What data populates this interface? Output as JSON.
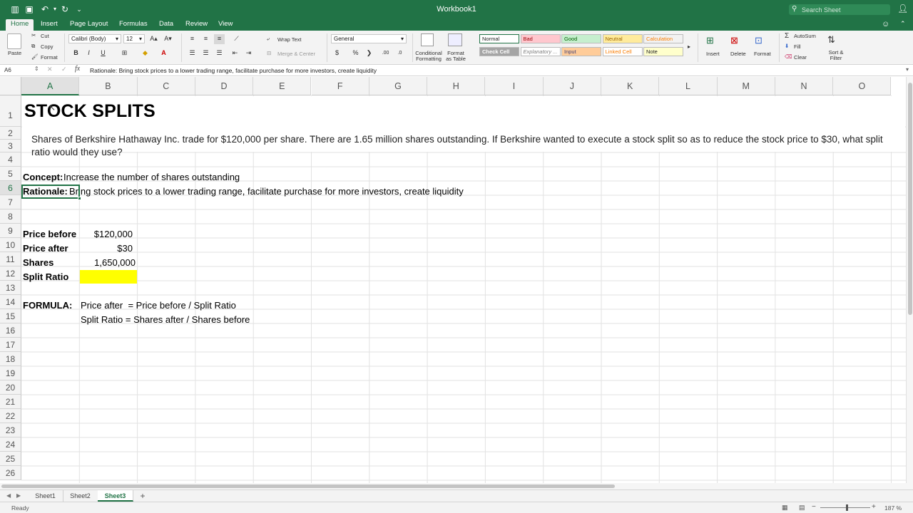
{
  "window": {
    "title": "Workbook1"
  },
  "search": {
    "placeholder": "Search Sheet"
  },
  "tabs": [
    "Home",
    "Insert",
    "Page Layout",
    "Formulas",
    "Data",
    "Review",
    "View"
  ],
  "ribbon": {
    "clipboard": {
      "paste": "Paste",
      "cut": "Cut",
      "copy": "Copy",
      "format": "Format"
    },
    "font": {
      "name": "Calibri (Body)",
      "size": "12",
      "bold": "B",
      "italic": "I",
      "underline": "U"
    },
    "alignment": {
      "wrap_text": "Wrap Text",
      "merge_center": "Merge & Center"
    },
    "number": {
      "format": "General",
      "currency": "$",
      "percent": "%",
      "comma": "❯"
    },
    "styles": {
      "conditional_formatting": [
        "Conditional",
        "Formatting"
      ],
      "format_as_table": [
        "Format",
        "as Table"
      ],
      "cells": [
        {
          "label": "Normal",
          "bg": "#ffffff",
          "fg": "#222222"
        },
        {
          "label": "Bad",
          "bg": "#ffc7ce",
          "fg": "#9c0006"
        },
        {
          "label": "Good",
          "bg": "#c6efce",
          "fg": "#006100"
        },
        {
          "label": "Neutral",
          "bg": "#ffeb9c",
          "fg": "#9c6500"
        },
        {
          "label": "Calculation",
          "bg": "#f2f2f2",
          "fg": "#fa7d00"
        },
        {
          "label": "Check Cell",
          "bg": "#a5a5a5",
          "fg": "#ffffff"
        },
        {
          "label": "Explanatory ...",
          "bg": "#ffffff",
          "fg": "#7f7f7f"
        },
        {
          "label": "Input",
          "bg": "#ffcc99",
          "fg": "#3f3f76"
        },
        {
          "label": "Linked Cell",
          "bg": "#ffffff",
          "fg": "#fa7d00"
        },
        {
          "label": "Note",
          "bg": "#ffffcc",
          "fg": "#222222"
        }
      ]
    },
    "cells": {
      "insert": "Insert",
      "delete": "Delete",
      "format": "Format"
    },
    "editing": {
      "autosum": "AutoSum",
      "fill": "Fill",
      "clear": "Clear",
      "sort_filter": [
        "Sort &",
        "Filter"
      ]
    }
  },
  "formula_bar": {
    "name_box": "A6",
    "content": "Rationale: Bring stock prices to a lower trading range, facilitate purchase for more investors, create liquidity"
  },
  "grid": {
    "columns": [
      "A",
      "B",
      "C",
      "D",
      "E",
      "F",
      "G",
      "H",
      "I",
      "J",
      "K",
      "L",
      "M",
      "N",
      "O"
    ],
    "rows": [
      "1",
      "2",
      "3",
      "4",
      "5",
      "6",
      "7",
      "8",
      "9",
      "10",
      "11",
      "12",
      "13",
      "14",
      "15",
      "16",
      "17",
      "18",
      "19",
      "20",
      "21",
      "22",
      "23",
      "24",
      "25",
      "26"
    ],
    "selected_column": "A",
    "selected_row": "6"
  },
  "sheet": {
    "title": "STOCK SPLITS",
    "question": "Shares of Berkshire Hathaway Inc. trade for $120,000 per share. There are 1.65 million shares outstanding. If Berkshire wanted to execute a stock split so as to reduce the stock price to $30, what split ratio would they use?",
    "concept_label": "Concept:",
    "concept_text": "Increase the number of shares outstanding",
    "rationale_label": "Rationale:",
    "rationale_text": "Bring stock prices to a lower trading range, facilitate purchase for more investors, create liquidity",
    "price_before_label": "Price before",
    "price_before_value": "$120,000",
    "price_after_label": "Price after",
    "price_after_value": "$30",
    "shares_label": "Shares",
    "shares_value": "1,650,000",
    "split_ratio_label": "Split Ratio",
    "formula_label": "FORMULA:",
    "formula_line1": "Price after  = Price before / Split Ratio",
    "formula_line2": "Split Ratio = Shares after / Shares before",
    "highlight_color": "#ffff00"
  },
  "sheet_tabs": [
    "Sheet1",
    "Sheet2",
    "Sheet3"
  ],
  "active_sheet": "Sheet3",
  "status": {
    "text": "Ready",
    "zoom": "187 %"
  },
  "accent_color": "#217346"
}
